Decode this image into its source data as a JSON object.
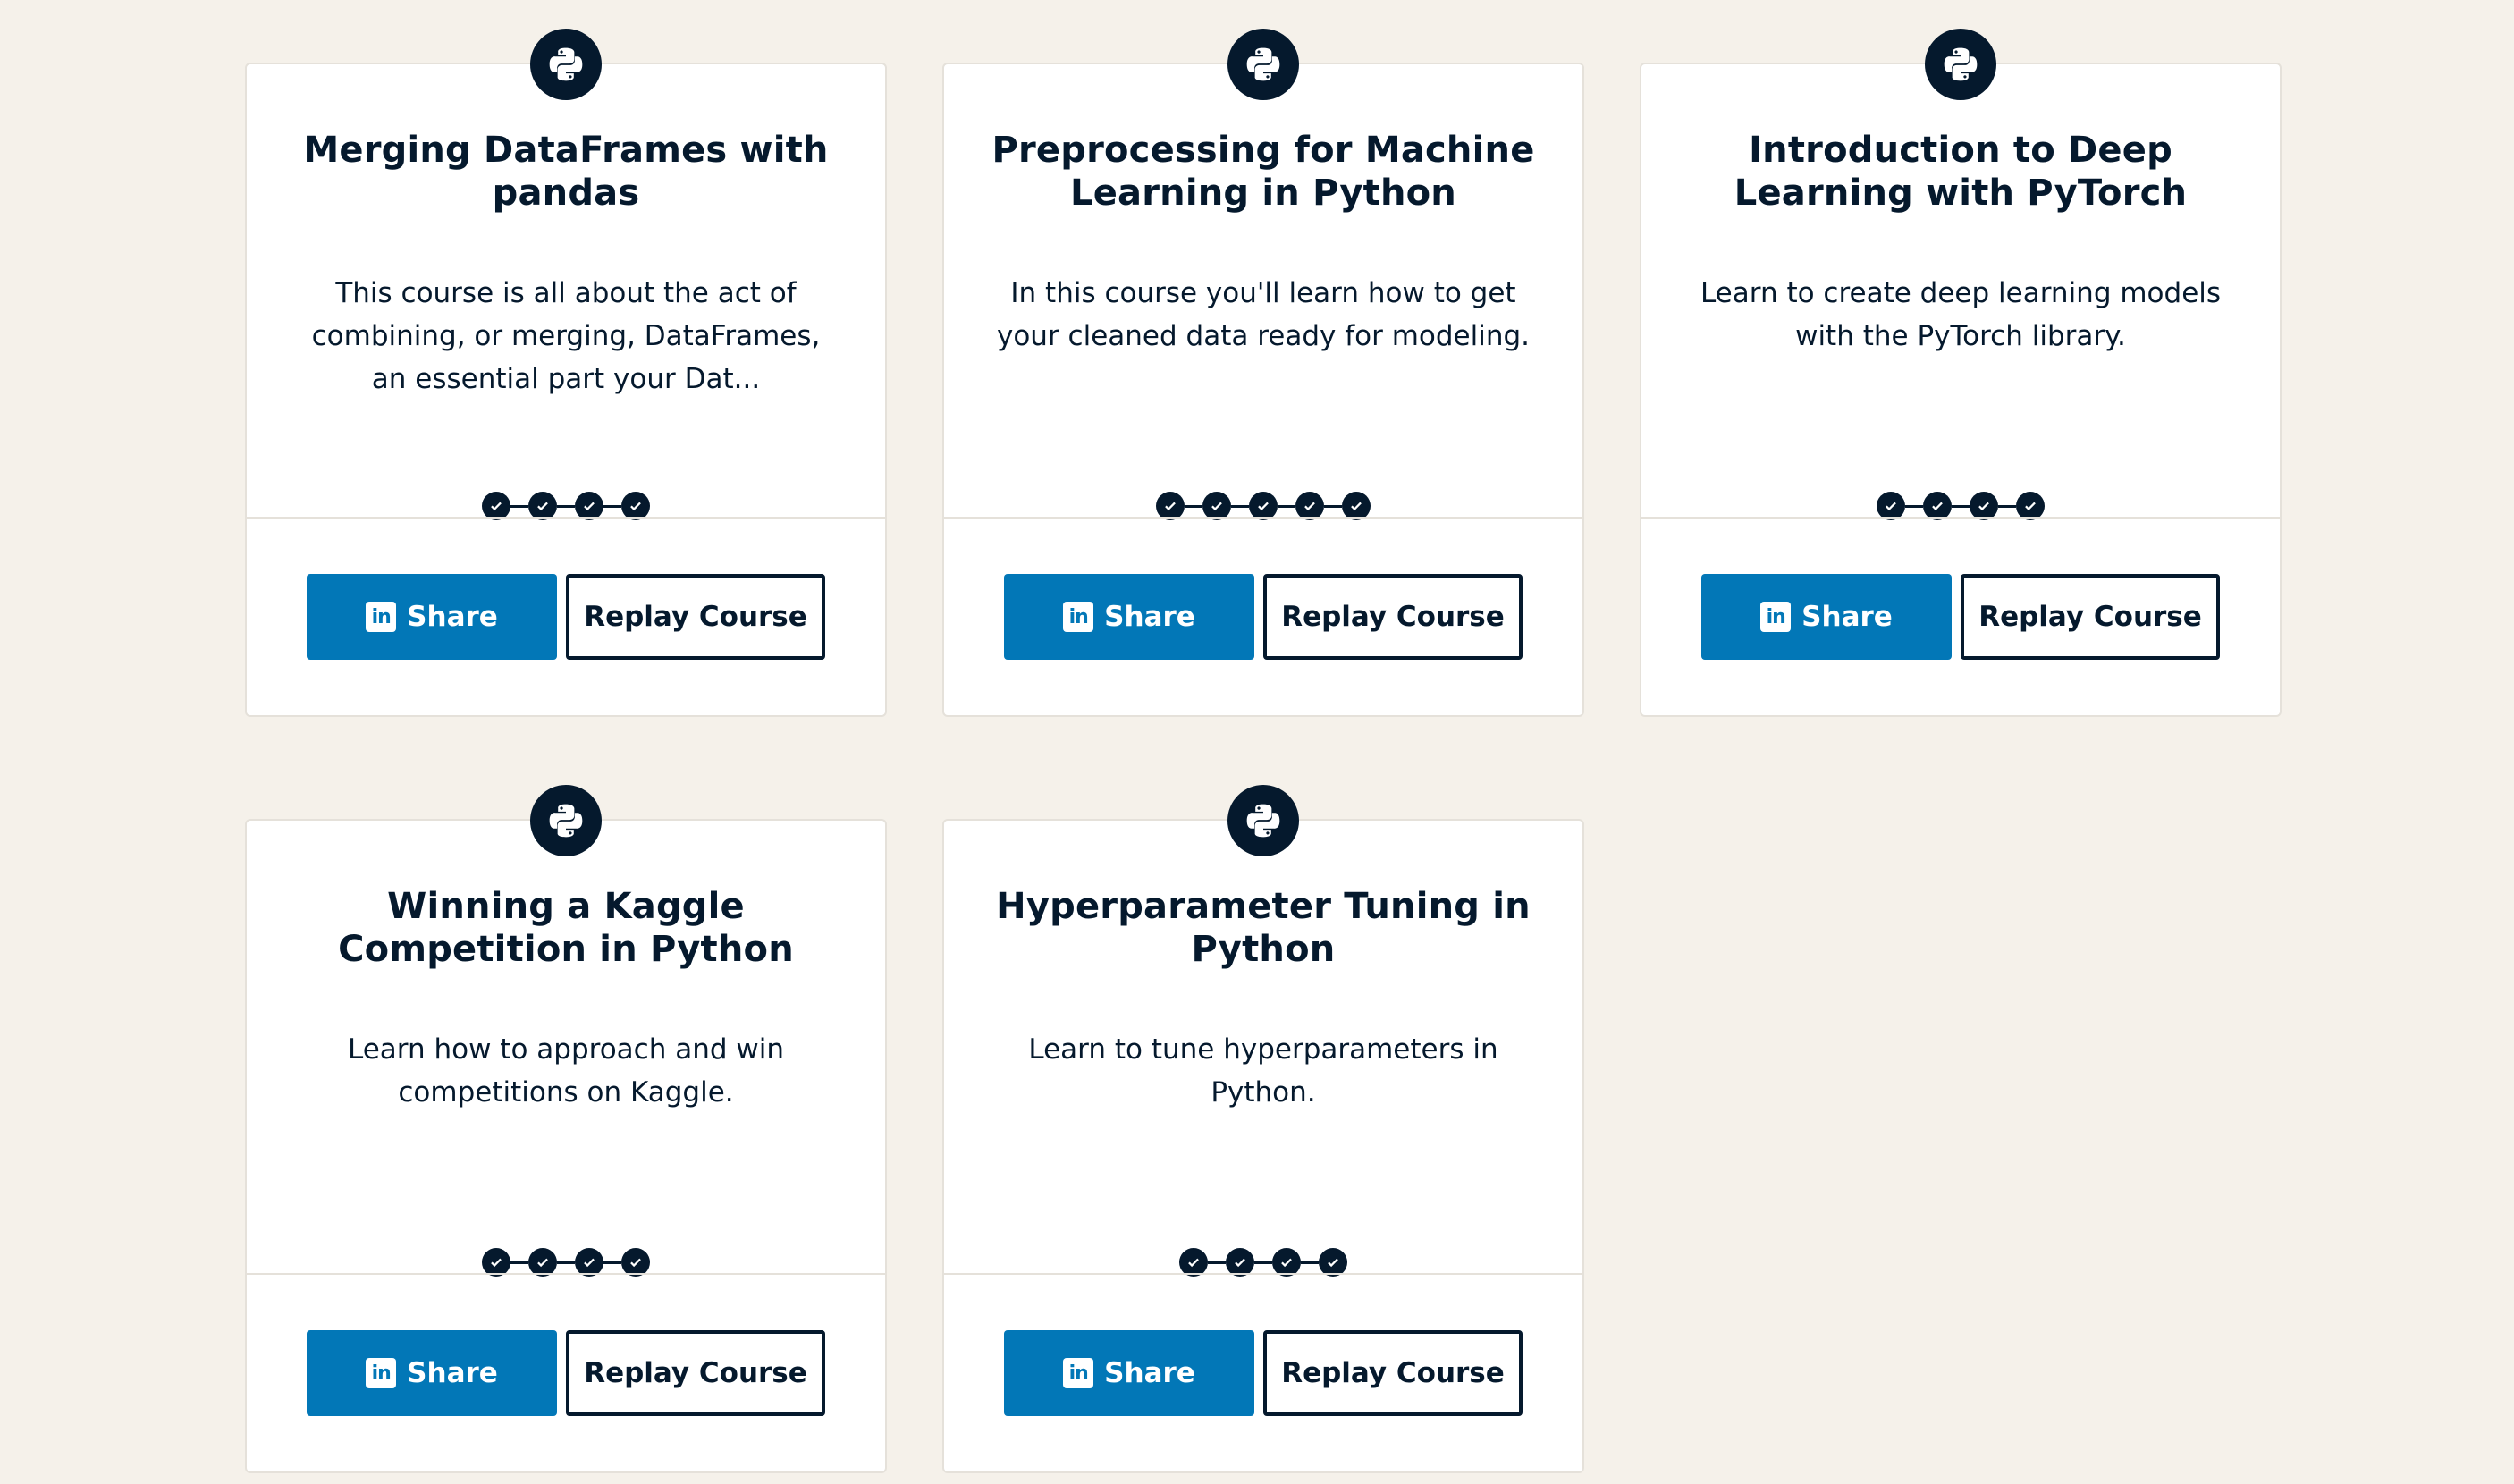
{
  "colors": {
    "page_background": "#f5f1ea",
    "card_background": "#ffffff",
    "navy": "#05192d",
    "linkedin_blue": "#0277b7"
  },
  "icons": {
    "course": "python-icon",
    "share": "linkedin-icon",
    "progress": "check-icon"
  },
  "share_label": "Share",
  "replay_label": "Replay Course",
  "courses": [
    {
      "title": "Merging DataFrames with pandas",
      "description": "This course is all about the act of combining, or merging, DataFrames, an essential part your Dat...",
      "chapters_completed": 4
    },
    {
      "title": "Preprocessing for Machine Learning in Python",
      "description": "In this course you'll learn how to get your cleaned data ready for modeling.",
      "chapters_completed": 5
    },
    {
      "title": "Introduction to Deep Learning with PyTorch",
      "description": "Learn to create deep learning models with the PyTorch library.",
      "chapters_completed": 4
    },
    {
      "title": "Winning a Kaggle Competition in Python",
      "description": "Learn how to approach and win competitions on Kaggle.",
      "chapters_completed": 4
    },
    {
      "title": "Hyperparameter Tuning in Python",
      "description": "Learn to tune hyperparameters in Python.",
      "chapters_completed": 4
    }
  ]
}
